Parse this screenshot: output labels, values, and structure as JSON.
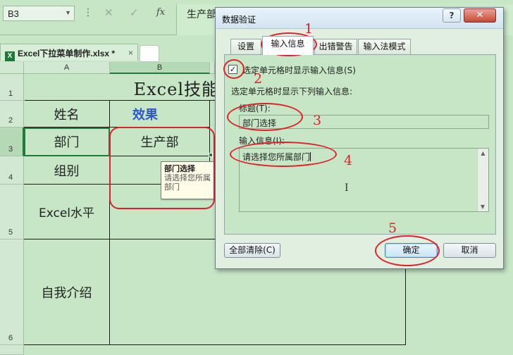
{
  "formula_bar": {
    "name_box": "B3",
    "fx_label": "fx",
    "cancel_glyph": "✕",
    "enter_glyph": "✓",
    "content": "生产部"
  },
  "workbook_tab": {
    "label": "Excel下拉菜单制作.xlsx *",
    "close_glyph": "×"
  },
  "columns": [
    "A",
    "B"
  ],
  "rows": [
    "1",
    "2",
    "3",
    "4",
    "5",
    "6"
  ],
  "sheet": {
    "title": "Excel技能",
    "cells": {
      "a2": "姓名",
      "b2": "效果",
      "a3": "部门",
      "b3": "生产部",
      "a4": "组别",
      "a5": "Excel水平",
      "a6": "自我介绍"
    }
  },
  "tooltip": {
    "title": "部门选择",
    "message": "请选择您所属部门"
  },
  "dialog": {
    "title": "数据验证",
    "help_glyph": "?",
    "close_glyph": "✕",
    "tabs": [
      "设置",
      "输入信息",
      "出错警告",
      "输入法模式"
    ],
    "active_tab": "输入信息",
    "checkbox_label": "选定单元格时显示输入信息(S)",
    "checkbox_checked": true,
    "checkbox_glyph": "✓",
    "subtitle": "选定单元格时显示下列输入信息:",
    "title_label": "标题(T):",
    "title_value": "部门选择",
    "message_label": "输入信息(I):",
    "message_value": "请选择您所属部门",
    "clear_all_button": "全部清除(C)",
    "ok_button": "确定",
    "cancel_button": "取消"
  },
  "annotations": {
    "color": "#e0202a",
    "numbers": [
      "1",
      "2",
      "3",
      "4",
      "5"
    ]
  }
}
